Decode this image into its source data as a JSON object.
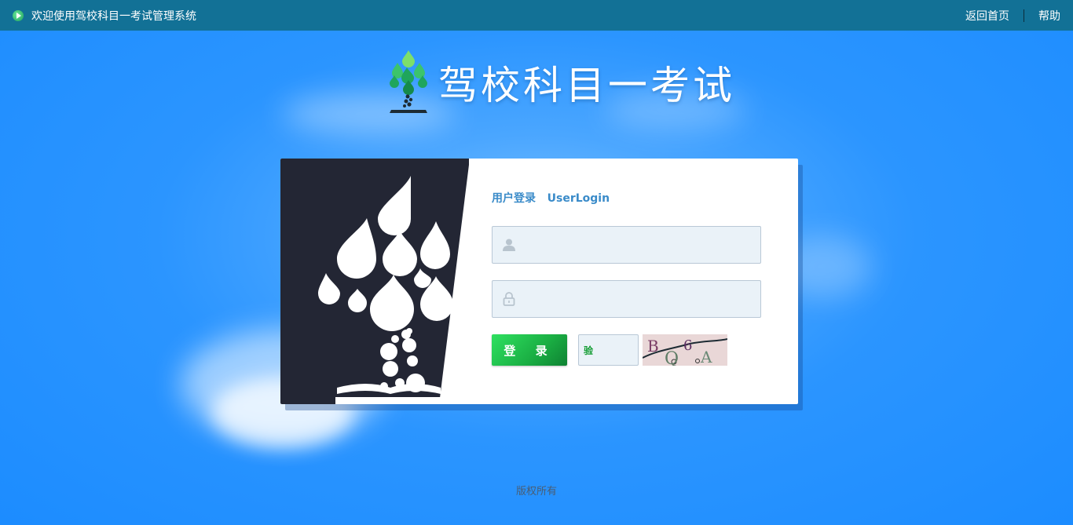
{
  "header": {
    "welcome_text": "欢迎使用驾校科目一考试管理系统",
    "home_link": "返回首页",
    "help_link": "帮助"
  },
  "brand": {
    "title": "驾校科目一考试"
  },
  "login": {
    "heading_cn": "用户登录",
    "heading_en": "UserLogin",
    "username_placeholder": "",
    "password_placeholder": "",
    "submit_label": "登 录",
    "captcha_label": "验",
    "captcha_text": "BQ6A"
  },
  "footer": {
    "copyright": "版权所有"
  },
  "colors": {
    "topbar": "#127196",
    "background": "#1c8cff",
    "accent_text": "#3a8bc9",
    "button": "#1aae43",
    "card_dark": "#232634"
  },
  "icons": {
    "topbar": "play-icon",
    "username": "user-icon",
    "password": "lock-icon"
  }
}
